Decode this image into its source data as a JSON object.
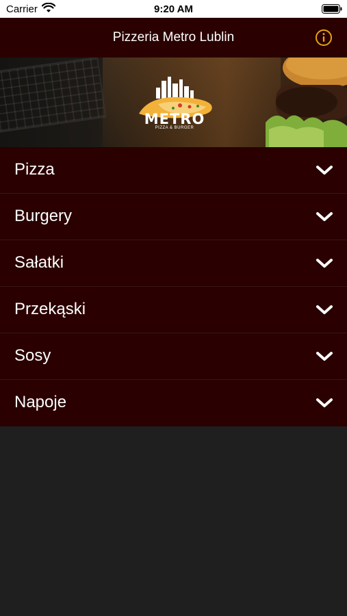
{
  "status_bar": {
    "carrier": "Carrier",
    "time": "9:20 AM"
  },
  "nav": {
    "title": "Pizzeria Metro Lublin",
    "info_icon": "info-circle-icon",
    "accent_color": "#e8a317"
  },
  "hero": {
    "logo_text": "METRO",
    "logo_subtitle": "PIZZA & BURGER"
  },
  "menu": {
    "items": [
      {
        "label": "Pizza"
      },
      {
        "label": "Burgery"
      },
      {
        "label": "Sałatki"
      },
      {
        "label": "Przekąski"
      },
      {
        "label": "Sosy"
      },
      {
        "label": "Napoje"
      }
    ],
    "expand_icon": "chevron-down-icon"
  },
  "colors": {
    "bar_background": "#2a0000",
    "page_background": "#1f1f20"
  }
}
